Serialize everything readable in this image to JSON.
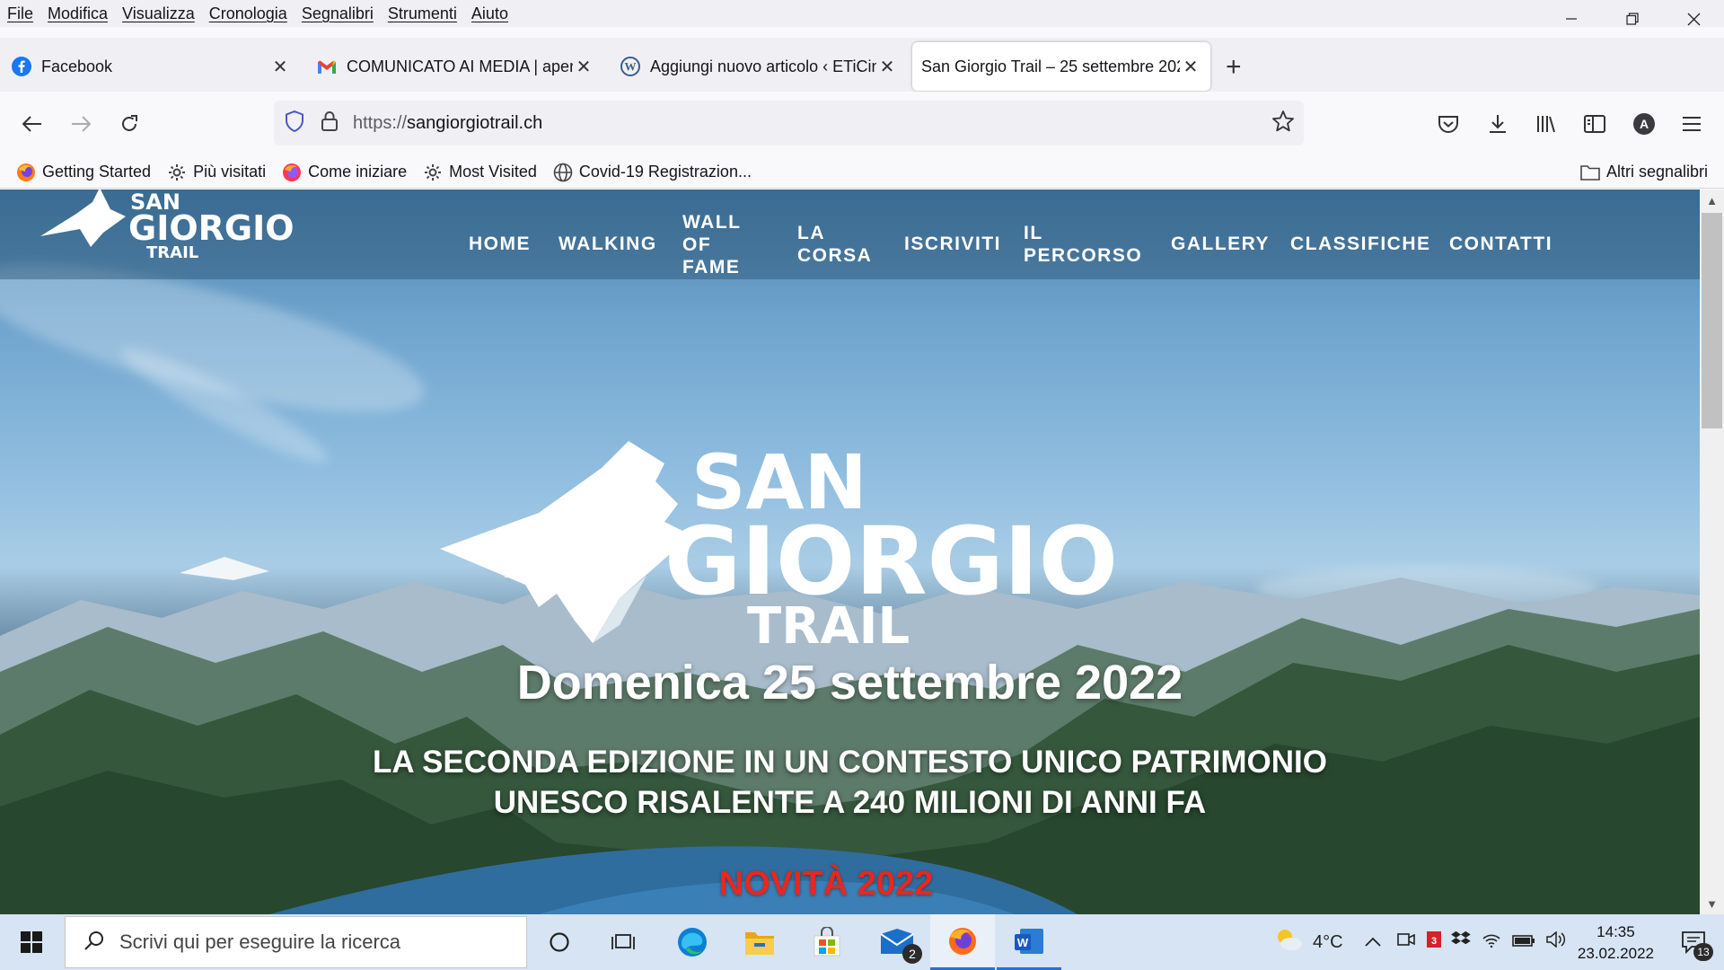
{
  "menu": [
    "File",
    "Modifica",
    "Visualizza",
    "Cronologia",
    "Segnalibri",
    "Strumenti",
    "Aiuto"
  ],
  "tabs": [
    {
      "title": "Facebook",
      "icon": "facebook-icon"
    },
    {
      "title": "COMUNICATO AI MEDIA | aperta",
      "icon": "gmail-icon"
    },
    {
      "title": "Aggiungi nuovo articolo ‹ ETiCinema",
      "icon": "wordpress-icon"
    },
    {
      "title": "San Giorgio Trail – 25 settembre 2022",
      "icon": "page-icon",
      "active": true
    }
  ],
  "url": {
    "protocol": "https://",
    "host": "sangiorgiotrail.ch"
  },
  "bookmarks": [
    {
      "label": "Getting Started",
      "icon": "firefox-icon"
    },
    {
      "label": "Più visitati",
      "icon": "gear-icon"
    },
    {
      "label": "Come iniziare",
      "icon": "firefox-icon"
    },
    {
      "label": "Most Visited",
      "icon": "gear-icon"
    },
    {
      "label": "Covid-19 Registrazion...",
      "icon": "globe-icon"
    }
  ],
  "other_bookmarks": "Altri segnalibri",
  "site": {
    "logo": {
      "line1": "SAN",
      "line2": "GIORGIO",
      "line3": "TRAIL"
    },
    "nav": [
      {
        "label": "HOME"
      },
      {
        "label": "WALKING"
      },
      {
        "label": "WALL\nOF\nFAME"
      },
      {
        "label": "LA\nCORSA"
      },
      {
        "label": "ISCRIVITI"
      },
      {
        "label": "IL\nPERCORSO"
      },
      {
        "label": "GALLERY"
      },
      {
        "label": "CLASSIFICHE"
      },
      {
        "label": "CONTATTI"
      }
    ],
    "hero": {
      "date": "Domenica 25 settembre 2022",
      "subtitle_line1": "LA SECONDA EDIZIONE IN UN CONTESTO UNICO PATRIMONIO",
      "subtitle_line2": "UNESCO RISALENTE A 240 MILIONI DI ANNI FA",
      "novita": "NOVITÀ 2022",
      "novita_color": "#e8271f"
    }
  },
  "taskbar": {
    "search_placeholder": "Scrivi qui per eseguire la ricerca",
    "mail_badge": "2",
    "weather": "4°C",
    "time": "14:35",
    "date": "23.02.2022",
    "notifications": "13"
  }
}
